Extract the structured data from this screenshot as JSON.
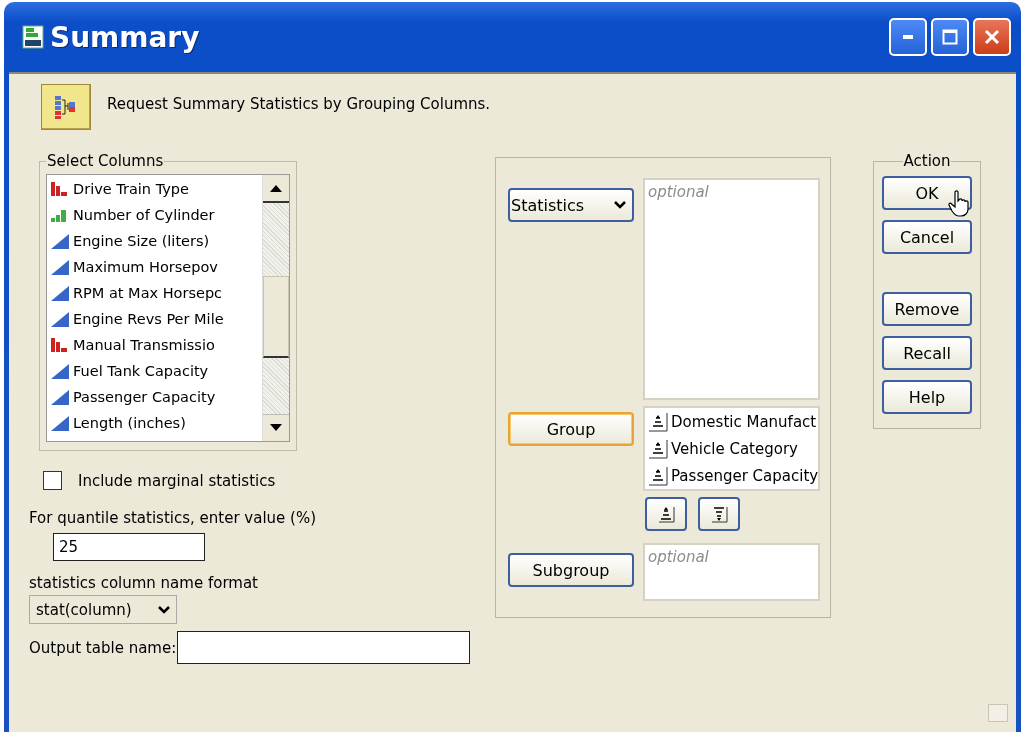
{
  "window": {
    "title": "Summary"
  },
  "header": {
    "text": "Request Summary Statistics by Grouping Columns."
  },
  "select_columns": {
    "title": "Select Columns",
    "items": [
      {
        "label": "Drive Train Type",
        "kind": "nominal"
      },
      {
        "label": "Number of Cylinder",
        "kind": "ordinal"
      },
      {
        "label": "Engine Size (liters)",
        "kind": "continuous"
      },
      {
        "label": "Maximum Horsepov",
        "kind": "continuous"
      },
      {
        "label": "RPM at Max Horsepc",
        "kind": "continuous"
      },
      {
        "label": "Engine Revs Per Mile",
        "kind": "continuous"
      },
      {
        "label": "Manual Transmissio",
        "kind": "nominal"
      },
      {
        "label": "Fuel Tank Capacity",
        "kind": "continuous"
      },
      {
        "label": "Passenger Capacity",
        "kind": "continuous"
      },
      {
        "label": "Length (inches)",
        "kind": "continuous"
      }
    ]
  },
  "marginal": {
    "label": "Include marginal statistics",
    "checked": false
  },
  "quantile": {
    "label": "For quantile statistics, enter value (%)",
    "value": "25"
  },
  "name_format": {
    "label": "statistics column name format",
    "value": "stat(column)"
  },
  "output_table": {
    "label": "Output table name:"
  },
  "roles": [
    {
      "kind": "dropdown",
      "button": "Statistics",
      "focused": false,
      "placeholder": "optional"
    },
    {
      "kind": "plain",
      "button": "Group",
      "focused": true,
      "items": [
        "Domestic Manufact",
        "Vehicle Category",
        "Passenger Capacity"
      ]
    },
    {
      "kind": "plain",
      "button": "Subgroup",
      "focused": false,
      "placeholder": "optional"
    }
  ],
  "action": {
    "title": "Action",
    "button_groups": [
      [
        "OK",
        "Cancel"
      ],
      [
        "Remove",
        "Recall",
        "Help"
      ]
    ]
  }
}
